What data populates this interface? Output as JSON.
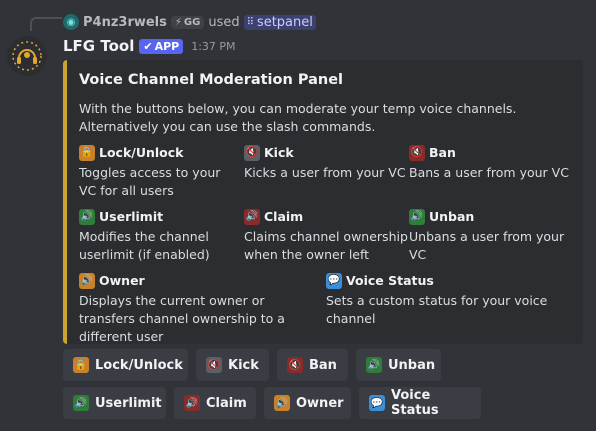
{
  "reply": {
    "username": "P4nz3rwels",
    "tag": "GG",
    "used_text": "used",
    "command": "setpanel"
  },
  "message": {
    "bot_name": "LFG Tool",
    "app_badge": "APP",
    "timestamp": "1:37 PM"
  },
  "embed": {
    "accent_color": "#c9a430",
    "title": "Voice Channel Moderation Panel",
    "description_line1": "With the buttons below, you can moderate your temp voice channels.",
    "description_line2": "Alternatively you can use the slash commands.",
    "fields": [
      {
        "icon": "lock-icon",
        "name": "Lock/Unlock",
        "value": "Toggles access to your VC for all users"
      },
      {
        "icon": "kick-speaker-icon",
        "name": "Kick",
        "value": "Kicks a user from your VC"
      },
      {
        "icon": "ban-speaker-icon",
        "name": "Ban",
        "value": "Bans a user from your VC"
      },
      {
        "icon": "userlimit-speaker-icon",
        "name": "Userlimit",
        "value": "Modifies the channel userlimit (if enabled)"
      },
      {
        "icon": "claim-speaker-icon",
        "name": "Claim",
        "value": "Claims channel ownership when the owner left"
      },
      {
        "icon": "unban-speaker-icon",
        "name": "Unban",
        "value": "Unbans a user from your VC"
      },
      {
        "icon": "owner-speaker-icon",
        "name": "Owner",
        "value": "Displays the current owner or transfers channel ownership to a different user"
      },
      {
        "icon": "speech-bubble-icon",
        "name": "Voice Status",
        "value": "Sets a custom status for your voice channel"
      }
    ]
  },
  "buttons": {
    "row1": [
      "Lock/Unlock",
      "Kick",
      "Ban",
      "Unban"
    ],
    "row2": [
      "Userlimit",
      "Claim",
      "Owner",
      "Voice Status"
    ]
  }
}
